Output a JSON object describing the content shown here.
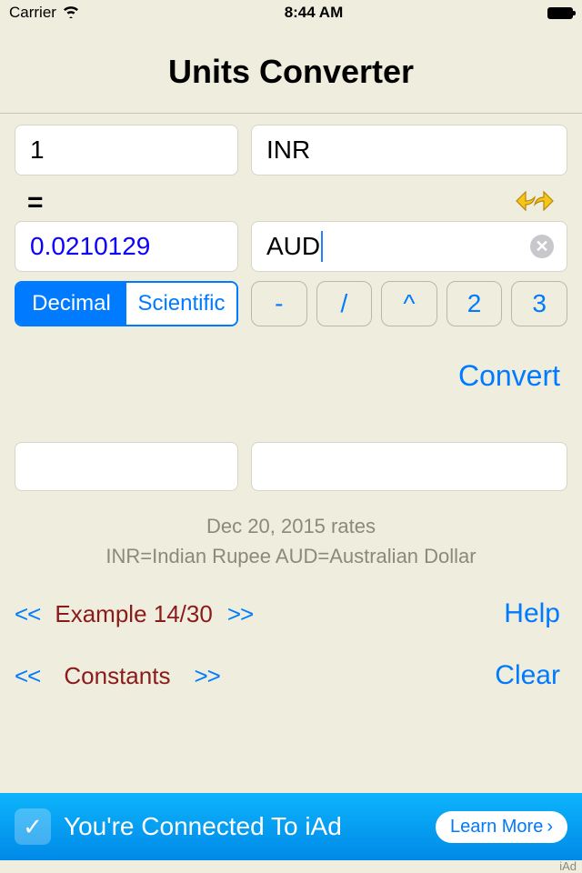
{
  "status": {
    "carrier": "Carrier",
    "time": "8:44 AM"
  },
  "title": "Units Converter",
  "from": {
    "value": "1",
    "unit": "INR"
  },
  "equals": "=",
  "to": {
    "value": "0.0210129",
    "unit": "AUD"
  },
  "format": {
    "decimal": "Decimal",
    "scientific": "Scientific",
    "active": "decimal"
  },
  "operators": [
    "-",
    "/",
    "^",
    "2",
    "3"
  ],
  "convert": "Convert",
  "info": {
    "line1": "Dec 20, 2015 rates",
    "line2": "INR=Indian Rupee  AUD=Australian Dollar"
  },
  "examples": {
    "prev": "<<",
    "label": "Example 14/30",
    "next": ">>",
    "help": "Help"
  },
  "constants": {
    "prev": "<<",
    "label": "Constants",
    "next": ">>",
    "clear": "Clear"
  },
  "banner": {
    "text": "You're Connected To iAd",
    "button": "Learn More",
    "attribution": "iAd"
  }
}
